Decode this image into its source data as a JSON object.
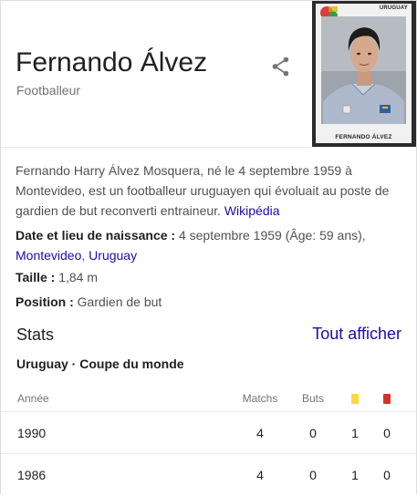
{
  "header": {
    "title": "Fernando Álvez",
    "subtitle": "Footballeur",
    "share_icon": "share-icon",
    "sticker": {
      "country": "URUGUAY",
      "name": "FERNANDO ÁLVEZ"
    }
  },
  "description": {
    "text": "Fernando Harry Álvez Mosquera, né le 4 septembre 1959 à Montevideo, est un footballeur uruguayen qui évoluait au poste de gardien de but reconverti entraineur.",
    "source_link": "Wikipédia"
  },
  "facts": {
    "birth": {
      "label": "Date et lieu de naissance :",
      "value": "4 septembre 1959 (Âge: 59 ans),",
      "link1": "Montevideo",
      "separator": ",",
      "link2": "Uruguay"
    },
    "height": {
      "label": "Taille :",
      "value": "1,84 m"
    },
    "position": {
      "label": "Position :",
      "value": "Gardien de but"
    }
  },
  "stats": {
    "title": "Stats",
    "see_all": "Tout afficher",
    "competition": "Uruguay · Coupe du monde",
    "columns": {
      "year": "Année",
      "matchs": "Matchs",
      "buts": "Buts",
      "yellow_card_color": "#fdd835",
      "red_card_color": "#d93025"
    },
    "rows": [
      {
        "year": "1990",
        "matchs": "4",
        "buts": "0",
        "yellow": "1",
        "red": "0"
      },
      {
        "year": "1986",
        "matchs": "4",
        "buts": "0",
        "yellow": "1",
        "red": "0"
      }
    ]
  },
  "colors": {
    "link": "#1a0dab",
    "secondary_text": "#70757a",
    "body_text": "#4d5156"
  }
}
